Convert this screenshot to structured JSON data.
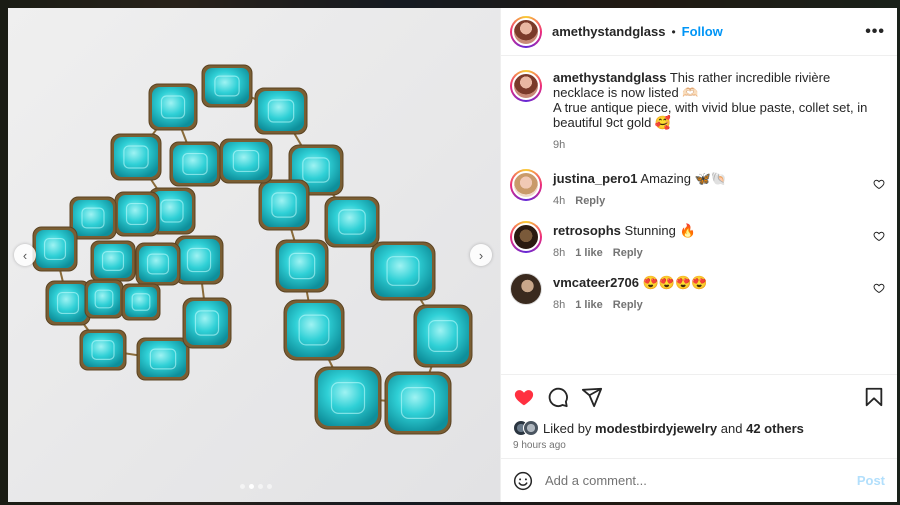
{
  "post": {
    "author": "amethystandglass",
    "separator": "•",
    "follow_label": "Follow",
    "more_label": "•••",
    "caption": {
      "username": "amethystandglass",
      "line1": "This rather incredible rivière necklace is now listed 🫶🏻",
      "line2": "A true antique piece, with vivid blue paste, collet set, in beautiful 9ct gold 🥰",
      "time": "9h"
    },
    "carousel": {
      "prev_label": "‹",
      "next_label": "›",
      "slide_count": 4,
      "active_slide": 1
    }
  },
  "comments": [
    {
      "username": "justina_pero1",
      "text": "Amazing 🦋🐚",
      "time": "4h",
      "likes": "",
      "reply": "Reply"
    },
    {
      "username": "retrosophs",
      "text": "Stunning 🔥",
      "time": "8h",
      "likes": "1 like",
      "reply": "Reply"
    },
    {
      "username": "vmcateer2706",
      "text": "😍😍😍😍",
      "time": "8h",
      "likes": "1 like",
      "reply": "Reply"
    }
  ],
  "actions": {
    "icons": [
      "heart-filled-icon",
      "comment-icon",
      "share-icon",
      "bookmark-icon"
    ],
    "liked_prefix": "Liked by",
    "liked_user": "modestbirdyjewelry",
    "liked_and": "and",
    "liked_others": "42 others",
    "timestamp": "9 hours ago"
  },
  "compose": {
    "placeholder": "Add a comment...",
    "post_label": "Post"
  },
  "colors": {
    "accent": "#0095f6",
    "like_red": "#ff3040",
    "stone": "#2cc9d2",
    "gold": "#8a6b3a"
  }
}
